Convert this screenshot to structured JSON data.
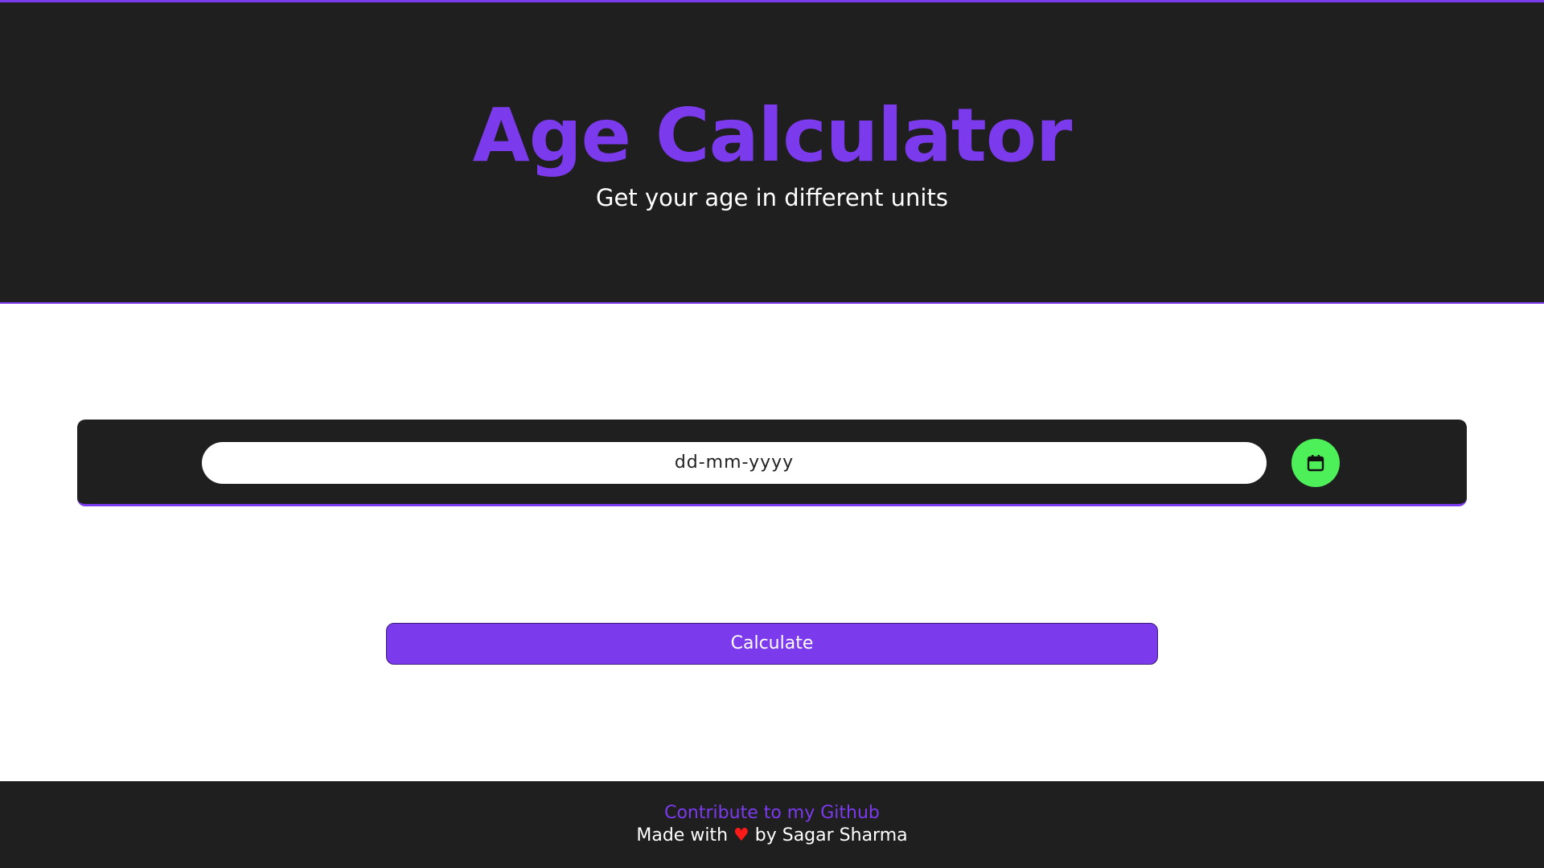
{
  "header": {
    "title": "Age Calculator",
    "subtitle": "Get your age in different units"
  },
  "form": {
    "date_placeholder": "dd-mm-yyyy",
    "calendar_icon": "calendar-icon",
    "calculate_label": "Calculate"
  },
  "footer": {
    "link_text": "Contribute to my Github",
    "made_with": "Made with",
    "heart_icon": "heart-icon",
    "by_text": "by Sagar Sharma"
  },
  "colors": {
    "accent": "#7c3aed",
    "dark_bg": "#1f1f1f",
    "calendar_button": "#4ef05a",
    "heart": "#ff1a1a"
  }
}
